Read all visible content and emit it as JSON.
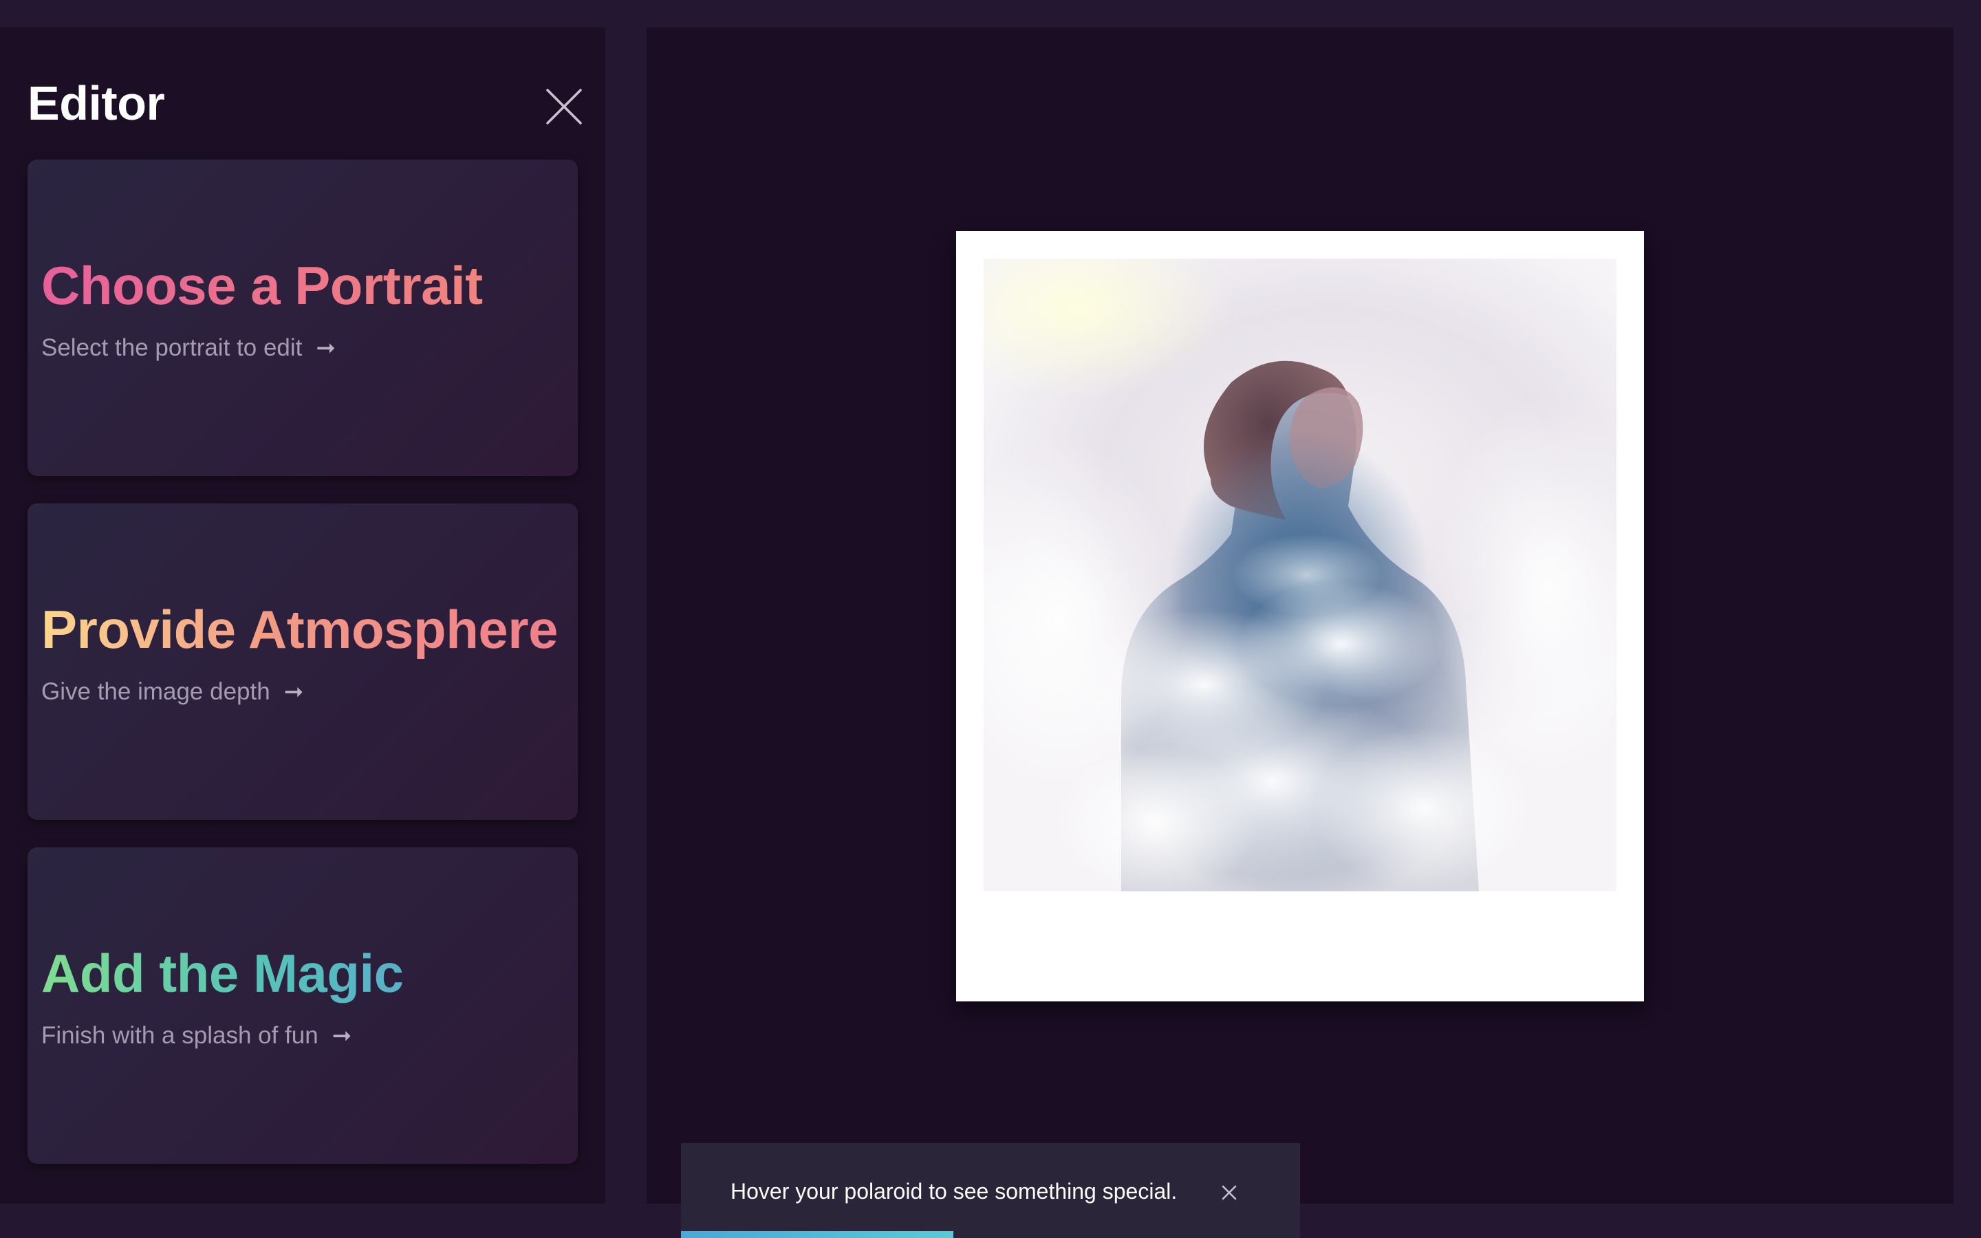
{
  "sidebar": {
    "title": "Editor",
    "close_icon": "close-icon",
    "cards": [
      {
        "title": "Choose a Portrait",
        "subtitle": "Select the portrait to edit",
        "arrow": "➞",
        "gradient": [
          "#e8609a",
          "#f1857e"
        ]
      },
      {
        "title": "Provide Atmosphere",
        "subtitle": "Give the image depth",
        "arrow": "➞",
        "gradient": [
          "#fcd58c",
          "#ef7f8b"
        ]
      },
      {
        "title": "Add the Magic",
        "subtitle": "Finish with a splash of fun",
        "arrow": "➞",
        "gradient": [
          "#7fdd8f",
          "#58b0c8"
        ]
      }
    ]
  },
  "canvas": {
    "polaroid": {
      "photo_subject": "double-exposure portrait of a woman with clouds"
    }
  },
  "toast": {
    "message": "Hover your polaroid to see something special.",
    "close_icon": "close-icon",
    "progress_fraction": 0.44,
    "progress_color": "#4aa8d6"
  },
  "colors": {
    "background": "#1b0d24",
    "sidebar": "#1c0f25",
    "card": "#2c1f3c",
    "text_primary": "#ffffff",
    "text_secondary": "#a59cb1"
  }
}
